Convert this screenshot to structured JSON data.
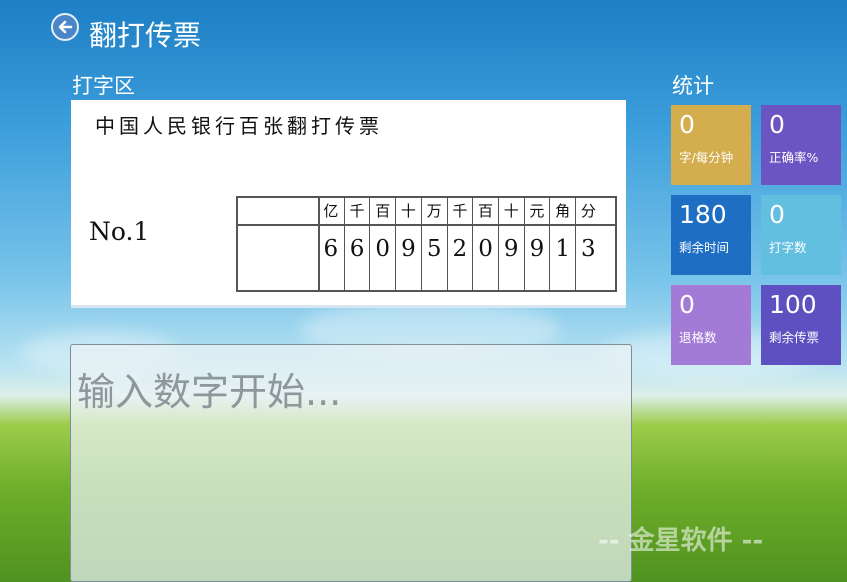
{
  "header": {
    "title": "翻打传票",
    "back_icon": "back-arrow-icon"
  },
  "typing_area": {
    "label": "打字区"
  },
  "ticket": {
    "heading": "中国人民银行百张翻打传票",
    "number": "No.1",
    "units": [
      "亿",
      "千",
      "百",
      "十",
      "万",
      "千",
      "百",
      "十",
      "元",
      "角",
      "分"
    ],
    "digits": [
      "6",
      "6",
      "0",
      "9",
      "5",
      "2",
      "0",
      "9",
      "9",
      "1",
      "3"
    ]
  },
  "input": {
    "placeholder": "输入数字开始..."
  },
  "stats": {
    "label": "统计",
    "tiles": [
      {
        "value": "0",
        "label": "字/每分钟",
        "color": "#d4ad4e"
      },
      {
        "value": "0",
        "label": "正确率%",
        "color": "#6a55c2"
      },
      {
        "value": "180",
        "label": "剩余时间",
        "color": "#1e6ec4"
      },
      {
        "value": "0",
        "label": "打字数",
        "color": "#63bfdf"
      },
      {
        "value": "0",
        "label": "退格数",
        "color": "#a37bd6"
      },
      {
        "value": "100",
        "label": "剩余传票",
        "color": "#5e50c0"
      }
    ]
  },
  "watermark": {
    "text": "-- 金星软件 --"
  }
}
